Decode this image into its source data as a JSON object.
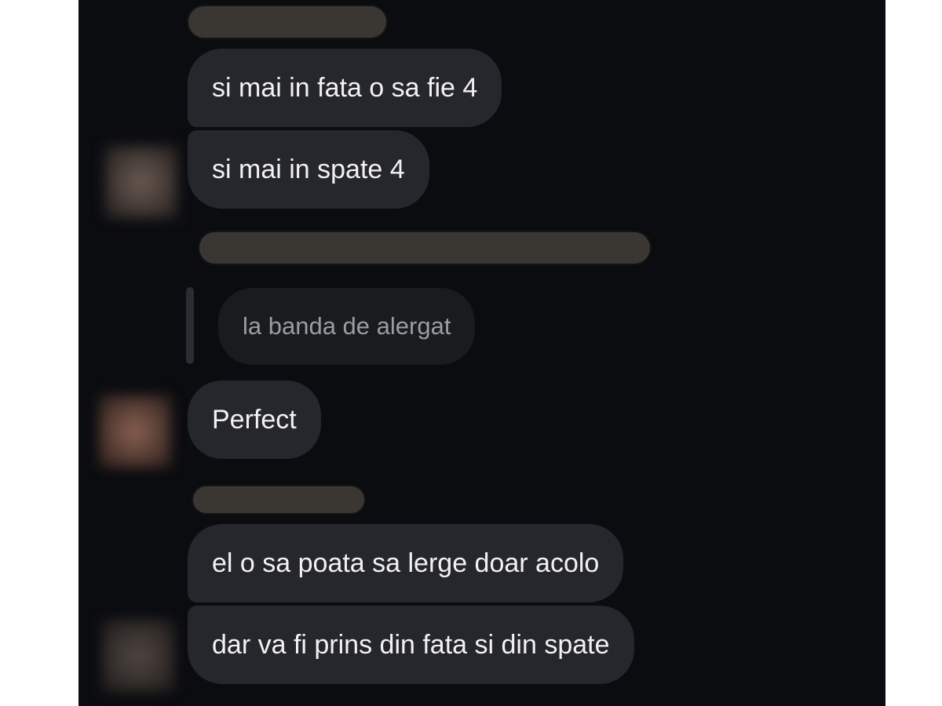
{
  "messages": [
    {
      "text": "si mai in fata o sa fie 4"
    },
    {
      "text": "si mai in spate 4"
    },
    {
      "text": "la banda de alergat"
    },
    {
      "text": "Perfect"
    },
    {
      "text": "el o sa poata sa lerge doar acolo"
    },
    {
      "text": "dar va fi prins din fata si din spate"
    }
  ]
}
